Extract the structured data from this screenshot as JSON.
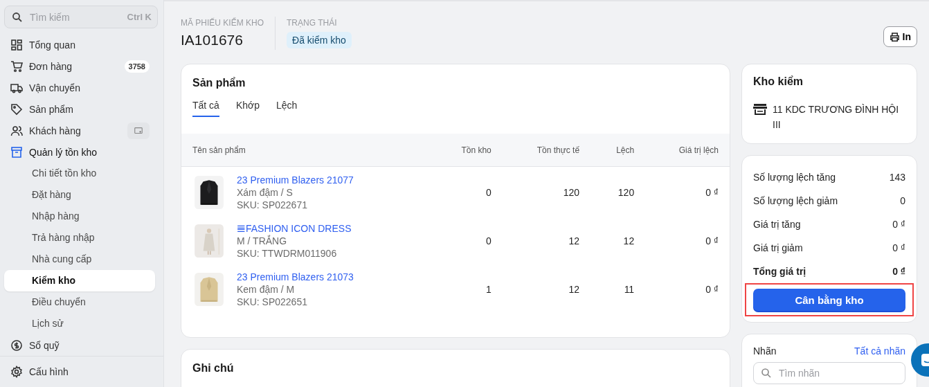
{
  "sidebar": {
    "search": {
      "placeholder": "Tìm kiếm",
      "shortcut": "Ctrl K"
    },
    "items": [
      {
        "label": "Tổng quan",
        "selected": false
      },
      {
        "label": "Đơn hàng",
        "selected": false,
        "badge": "3758"
      },
      {
        "label": "Vận chuyển",
        "selected": false
      },
      {
        "label": "Sản phẩm",
        "selected": false
      },
      {
        "label": "Khách hàng",
        "selected": false,
        "action": true
      },
      {
        "label": "Quản lý tồn kho",
        "selected": false,
        "expanded": true,
        "children": [
          {
            "label": "Chi tiết tồn kho",
            "selected": false
          },
          {
            "label": "Đặt hàng",
            "selected": false
          },
          {
            "label": "Nhập hàng",
            "selected": false
          },
          {
            "label": "Trả hàng nhập",
            "selected": false
          },
          {
            "label": "Nhà cung cấp",
            "selected": false
          },
          {
            "label": "Kiểm kho",
            "selected": true
          },
          {
            "label": "Điều chuyển",
            "selected": false
          },
          {
            "label": "Lịch sử",
            "selected": false
          }
        ]
      },
      {
        "label": "Sổ quỹ",
        "selected": false
      }
    ],
    "footer": {
      "label": "Cấu hình"
    }
  },
  "header": {
    "code_label": "MÃ PHIẾU KIỂM KHO",
    "code": "IA101676",
    "status_label": "TRẠNG THÁI",
    "status": "Đã kiểm kho",
    "print_button": "In"
  },
  "products": {
    "title": "Sản phẩm",
    "tabs": [
      {
        "label": "Tất cả",
        "selected": true
      },
      {
        "label": "Khớp",
        "selected": false
      },
      {
        "label": "Lệch",
        "selected": false
      }
    ],
    "columns": [
      "Tên sản phẩm",
      "Tồn kho",
      "Tồn thực tế",
      "Lệch",
      "Giá trị lệch"
    ],
    "rows": [
      {
        "name": "23 Premium Blazers 21077",
        "variant": "Xám đậm / S",
        "sku": "SKU: SP022671",
        "stock": "0",
        "actual": "120",
        "diff": "120",
        "value": "0 ₫"
      },
      {
        "name": "𝌆FASHION ICON DRESS",
        "variant": "M / TRẮNG",
        "sku": "SKU: TTWDRM011906",
        "stock": "0",
        "actual": "12",
        "diff": "12",
        "value": "0 ₫"
      },
      {
        "name": "23 Premium Blazers 21073",
        "variant": "Kem đậm / M",
        "sku": "SKU: SP022651",
        "stock": "1",
        "actual": "12",
        "diff": "11",
        "value": "0 ₫"
      }
    ]
  },
  "notes": {
    "title": "Ghi chú"
  },
  "warehouse": {
    "title": "Kho kiểm",
    "name": "11 KDC TRƯƠNG ĐÌNH HỘI III"
  },
  "summary": {
    "rows": [
      {
        "kind": "row",
        "label": "Số lượng lệch tăng",
        "value": "143"
      },
      {
        "kind": "row",
        "label": "Số lượng lệch giảm",
        "value": "0"
      },
      {
        "kind": "row",
        "label": "Giá trị tăng",
        "value": "0 ₫"
      },
      {
        "kind": "row",
        "label": "Giá trị giảm",
        "value": "0 ₫"
      },
      {
        "kind": "total",
        "label": "Tổng giá trị",
        "value": "0 ₫"
      }
    ],
    "button": {
      "label": "Cân bằng kho",
      "highlighted": true
    }
  },
  "tags": {
    "title": "Nhãn",
    "link": "Tất cả nhãn",
    "search_placeholder": "Tìm nhãn"
  }
}
